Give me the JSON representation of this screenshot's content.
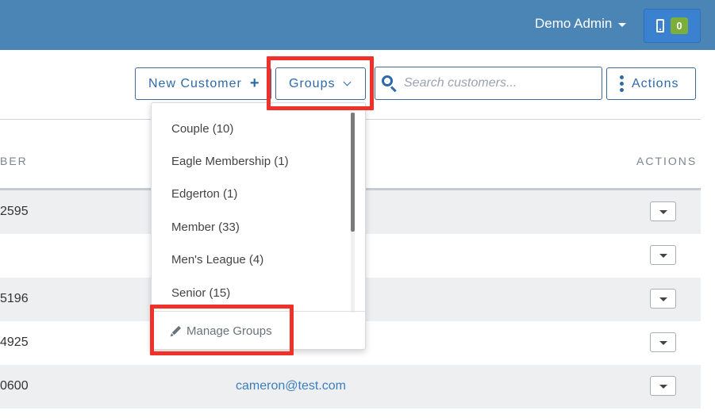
{
  "header": {
    "user_name": "Demo Admin",
    "device_count": "0",
    "icons": {
      "device": "mobile-phone-icon",
      "user_caret": "caret-down-icon"
    }
  },
  "toolbar": {
    "new_customer_label": "New Customer",
    "new_customer_icon": "plus",
    "groups_label": "Groups",
    "search_placeholder": "Search customers...",
    "actions_label": "Actions"
  },
  "table": {
    "columns": [
      "BER",
      "ACTIONS"
    ],
    "rows": [
      {
        "number": "2595",
        "email": ""
      },
      {
        "number": "",
        "email": ""
      },
      {
        "number": "5196",
        "email": ""
      },
      {
        "number": "4925",
        "email": ""
      },
      {
        "number": "0600",
        "email": "cameron@test.com"
      }
    ]
  },
  "groups_dropdown": {
    "items": [
      {
        "label": "Couple (10)"
      },
      {
        "label": "Eagle Membership (1)"
      },
      {
        "label": "Edgerton (1)"
      },
      {
        "label": "Member (33)"
      },
      {
        "label": "Men's League (4)"
      },
      {
        "label": "Senior (15)"
      }
    ],
    "manage_label": "Manage Groups"
  },
  "colors": {
    "header_bg": "#4a85b6",
    "accent": "#2e6aa8",
    "badge": "#7cae3a",
    "highlight": "#f0312a",
    "row_alt": "#eeeff1"
  }
}
